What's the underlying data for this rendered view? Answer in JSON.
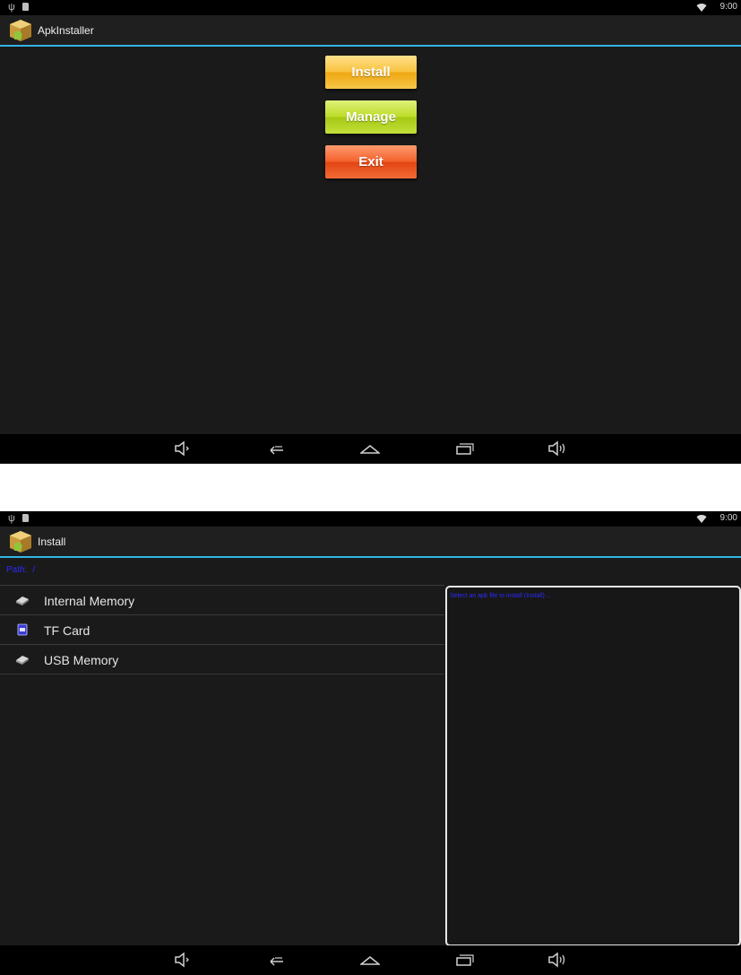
{
  "status_bar": {
    "time": "9:00",
    "icons": [
      "usb-icon",
      "sd-card-icon",
      "wifi-icon"
    ]
  },
  "screen1": {
    "title": "ApkInstaller",
    "buttons": {
      "install": "Install",
      "manage": "Manage",
      "exit": "Exit"
    },
    "button_colors": {
      "install": "#f8c340",
      "manage": "#bddd2a",
      "exit": "#f4622e"
    }
  },
  "screen2": {
    "title": "Install",
    "path_label": "Path:",
    "path_separator": "/",
    "storage_items": [
      {
        "label": "Internal Memory",
        "icon": "hard-drive-icon"
      },
      {
        "label": "TF Card",
        "icon": "sd-card-icon"
      },
      {
        "label": "USB Memory",
        "icon": "hard-drive-icon"
      }
    ],
    "info_message": "Select an apk file to install (Install) ..."
  },
  "navbar": {
    "icons": [
      "volume-down-icon",
      "back-icon",
      "home-icon",
      "recent-apps-icon",
      "volume-up-icon"
    ]
  },
  "colors": {
    "accent": "#33b5e5",
    "path_text": "#2b2bff",
    "background": "#1a1a1a"
  }
}
